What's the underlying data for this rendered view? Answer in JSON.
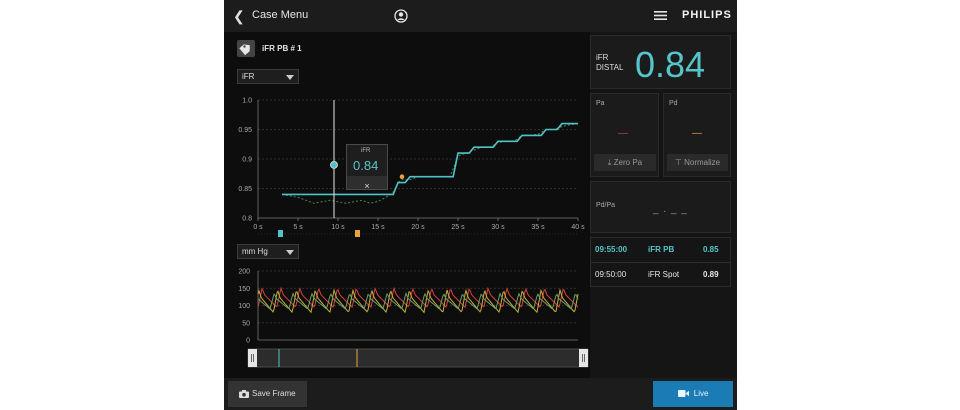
{
  "header": {
    "back_icon": "chevron-left-icon",
    "title": "Case Menu",
    "user_icon": "user-circle-icon",
    "menu_icon": "hamburger-menu-icon",
    "brand": "PHILIPS"
  },
  "recording": {
    "tag_icon": "tag-icon",
    "title": "iFR PB # 1"
  },
  "ifr_select": {
    "value": "iFR"
  },
  "pressure_select": {
    "value": "mm Hg"
  },
  "tooltip": {
    "label": "iFR",
    "value": "0.84",
    "close_glyph": "×"
  },
  "chart_data": [
    {
      "type": "line",
      "name": "iFR trend",
      "x": [
        3,
        5,
        7,
        9,
        11,
        13,
        14,
        15,
        16,
        17,
        17.5,
        18,
        19,
        20,
        21,
        22,
        23,
        24,
        25,
        26,
        27,
        28,
        29,
        30,
        31,
        32,
        33,
        34,
        35,
        36,
        37,
        38,
        39,
        40
      ],
      "series": [
        {
          "name": "iFR",
          "values": [
            0.84,
            0.84,
            0.84,
            0.84,
            0.84,
            0.84,
            0.84,
            0.84,
            0.84,
            0.84,
            0.86,
            0.86,
            0.87,
            0.87,
            0.87,
            0.87,
            0.87,
            0.87,
            0.91,
            0.91,
            0.92,
            0.92,
            0.92,
            0.93,
            0.93,
            0.93,
            0.94,
            0.94,
            0.94,
            0.95,
            0.95,
            0.96,
            0.96,
            0.96
          ]
        },
        {
          "values": [
            0.84,
            0.835,
            0.825,
            0.83,
            0.825,
            0.83,
            0.825,
            0.828,
            0.835,
            0.845,
            0.86,
            0.865,
            0.865,
            0.87,
            0.87,
            0.87,
            0.87,
            0.87,
            0.905,
            0.91,
            0.915,
            0.92,
            0.92,
            0.928,
            0.93,
            0.93,
            0.94,
            0.94,
            0.942,
            0.95,
            0.95,
            0.955,
            0.958,
            0.96
          ]
        }
      ],
      "cursor_x": 9.5,
      "marker_points": [
        {
          "x": 9.5,
          "y": 0.89
        },
        {
          "x": 18,
          "y": 0.87
        }
      ],
      "xlim": [
        0,
        40
      ],
      "ylim": [
        0.8,
        1.0
      ],
      "x_ticks": [
        "0 s",
        "5 s",
        "10 s",
        "15 s",
        "20 s",
        "25 s",
        "30 s",
        "35 s",
        "40 s"
      ],
      "y_ticks": [
        "0.8",
        "0.85",
        "0.9",
        "0.95",
        "1.0"
      ],
      "colors": {
        "ifr": "#4fc3c8",
        "marker_start": "#4fc3c8",
        "marker_end": "#e8a23c"
      }
    },
    {
      "type": "line",
      "name": "Pressure waveforms",
      "x_range_s": [
        0,
        40
      ],
      "ylim": [
        0,
        200
      ],
      "y_ticks": [
        "0",
        "50",
        "100",
        "150",
        "200"
      ],
      "beats": 17,
      "series": [
        {
          "color": "#d94040",
          "min": 95,
          "max": 150
        },
        {
          "color": "#c9b03a",
          "min": 80,
          "max": 145
        },
        {
          "color": "#6aa06a",
          "min": 90,
          "max": 135
        }
      ],
      "colors": {
        "teal_marker": "#4fc3c8",
        "orange_marker": "#e8a23c"
      }
    }
  ],
  "sidebar": {
    "ifr_distal": {
      "label_line1": "iFR",
      "label_line2": "DISTAL",
      "value": "0.84"
    },
    "pa": {
      "label": "Pa",
      "value": "—",
      "button": "Zero Pa",
      "button_icon": "download-icon"
    },
    "pd": {
      "label": "Pd",
      "value": "—",
      "button": "Normalize",
      "button_icon": "normalize-icon"
    },
    "pdpa": {
      "label": "Pd/Pa",
      "value": "_ . _ _"
    },
    "history": [
      {
        "time": "09:55:00",
        "name": "iFR PB",
        "value": "0.85",
        "color": "#56c5c9"
      },
      {
        "time": "09:50:00",
        "name": "iFR Spot",
        "value": "0.89",
        "color": "#e6e6e6"
      }
    ]
  },
  "footer": {
    "save_label": "Save Frame",
    "save_icon": "camera-icon",
    "live_label": "Live",
    "live_icon": "video-camera-icon"
  }
}
